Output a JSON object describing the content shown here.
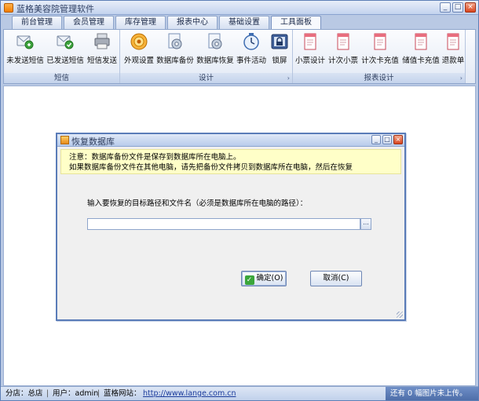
{
  "window": {
    "title": "蓝格美容院管理软件",
    "buttons": {
      "minimize": "_",
      "maximize": "□",
      "close": "×"
    }
  },
  "tabs": [
    {
      "label": "前台管理"
    },
    {
      "label": "会员管理"
    },
    {
      "label": "库存管理"
    },
    {
      "label": "报表中心"
    },
    {
      "label": "基础设置"
    },
    {
      "label": "工具面板",
      "active": true
    }
  ],
  "ribbon": {
    "groups": [
      {
        "label": "短信",
        "items": [
          {
            "label": "未发送短信",
            "icon": "sms-pending-icon"
          },
          {
            "label": "已发送短信",
            "icon": "sms-sent-icon"
          },
          {
            "label": "短信发送",
            "icon": "sms-send-icon"
          }
        ]
      },
      {
        "label": "设计",
        "items": [
          {
            "label": "外观设置",
            "icon": "appearance-icon"
          },
          {
            "label": "数据库备份",
            "icon": "db-backup-icon"
          },
          {
            "label": "数据库恢复",
            "icon": "db-restore-icon"
          },
          {
            "label": "事件活动",
            "icon": "event-clock-icon"
          },
          {
            "label": "锁屏",
            "icon": "lock-icon"
          }
        ]
      },
      {
        "label": "报表设计",
        "items": [
          {
            "label": "小票设计",
            "icon": "receipt-icon"
          },
          {
            "label": "计次小票",
            "icon": "receipt-icon"
          },
          {
            "label": "计次卡充值",
            "icon": "receipt-icon"
          },
          {
            "label": "储值卡充值",
            "icon": "receipt-icon"
          },
          {
            "label": "退款单",
            "icon": "receipt-icon"
          }
        ]
      }
    ],
    "launcher": "›"
  },
  "dialog": {
    "title": "恢复数据库",
    "notice_line1": "注意：数据库备份文件是保存到数据库所在电脑上。",
    "notice_line2": "如果数据库备份文件在其他电脑，请先把备份文件拷贝到数据库所在电脑，然后在恢复",
    "prompt": "输入要恢复的目标路径和文件名（必须是数据库所在电脑的路径）：",
    "path_value": "",
    "browse_label": "...",
    "ok_label": "确定(O)",
    "cancel_label": "取消(C)"
  },
  "status": {
    "store": "分店：总店",
    "user": "用户：admin",
    "site_label": "蓝格网站：",
    "site_url": "http://www.lange.com.cn",
    "upload": "还有 0 幅图片未上传。",
    "sep": "|"
  }
}
